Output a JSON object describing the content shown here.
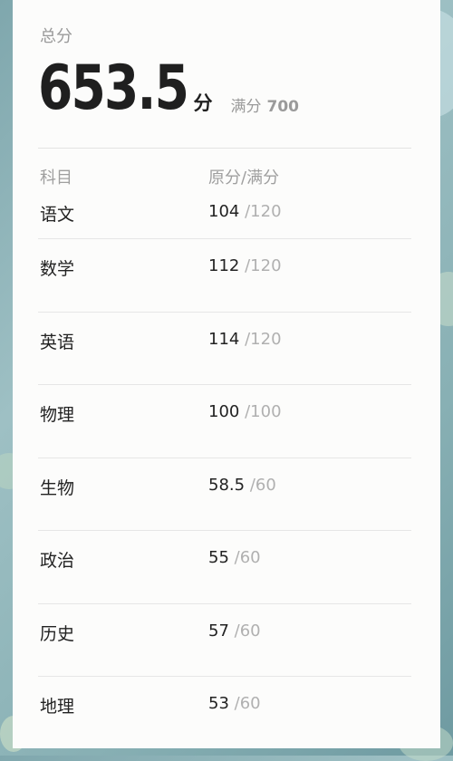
{
  "summary": {
    "total_label": "总分",
    "total_value": "653.5",
    "total_unit": "分",
    "full_mark_label": "满分",
    "full_mark_value": "700"
  },
  "table": {
    "headers": {
      "subject": "科目",
      "score": "原分/满分"
    },
    "rows": [
      {
        "subject": "语文",
        "score": "104",
        "max": "/120"
      },
      {
        "subject": "数学",
        "score": "112",
        "max": "/120"
      },
      {
        "subject": "英语",
        "score": "114",
        "max": "/120"
      },
      {
        "subject": "物理",
        "score": "100",
        "max": "/100"
      },
      {
        "subject": "生物",
        "score": "58.5",
        "max": "/60"
      },
      {
        "subject": "政治",
        "score": "55",
        "max": "/60"
      },
      {
        "subject": "历史",
        "score": "57",
        "max": "/60"
      },
      {
        "subject": "地理",
        "score": "53",
        "max": "/60"
      }
    ]
  },
  "colors": {
    "text_primary": "#222222",
    "text_muted": "#9a9a9a",
    "divider": "#e6e6e6",
    "card_background": "#fcfcfb"
  }
}
